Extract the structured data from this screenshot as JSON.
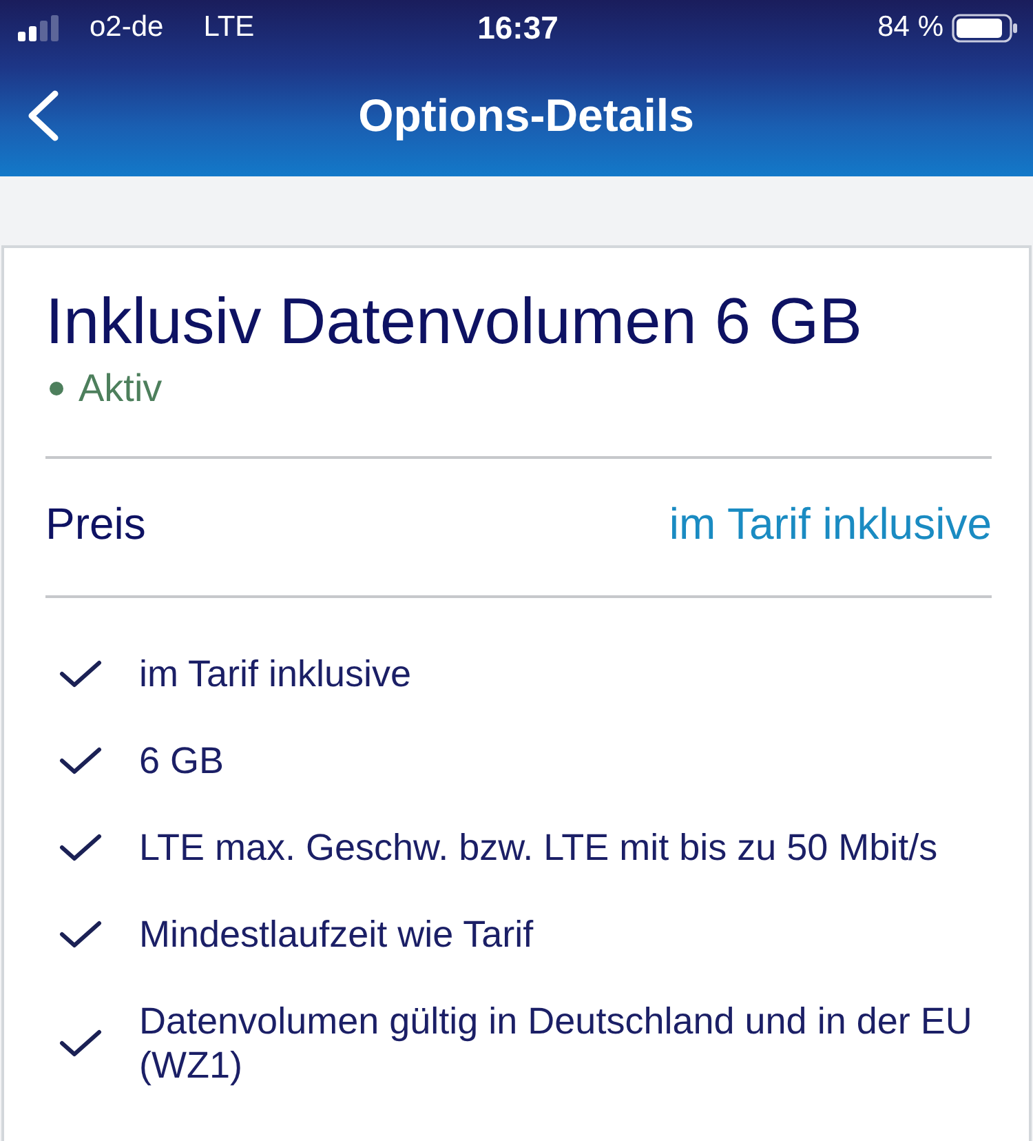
{
  "status_bar": {
    "carrier": "o2-de",
    "network": "LTE",
    "time": "16:37",
    "battery": "84 %"
  },
  "nav_bar": {
    "title": "Options-Details"
  },
  "option": {
    "title": "Inklusiv Datenvolumen 6 GB",
    "status": {
      "label": "Aktiv",
      "active": true
    },
    "price": {
      "label": "Preis",
      "value": "im Tarif inklusive"
    },
    "features": [
      "im Tarif inklusive",
      "6 GB",
      "LTE max. Geschw. bzw. LTE mit bis zu 50 Mbit/s",
      "Mindestlaufzeit wie Tarif",
      "Datenvolumen gültig in Deutschland und in der EU (WZ1)"
    ]
  }
}
